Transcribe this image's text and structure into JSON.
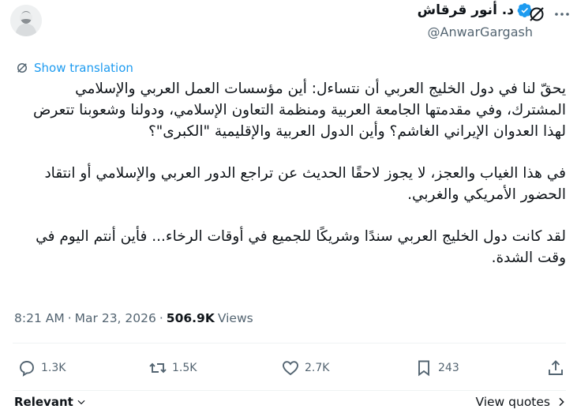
{
  "author": {
    "display_name": "د. أنور قرقاش",
    "handle": "@AnwarGargash"
  },
  "translate_label": "Show translation",
  "tweet": {
    "paragraphs": [
      "يحقّ لنا في دول الخليج العربي أن نتساءل: أين مؤسسات العمل العربي والإسلامي المشترك، وفي مقدمتها الجامعة العربية ومنظمة التعاون الإسلامي، ودولنا وشعوبنا تتعرض لهذا العدوان الإيراني الغاشم؟ وأين الدول العربية والإقليمية \"الكبرى\"؟",
      "في هذا الغياب والعجز، لا يجوز لاحقًا الحديث عن تراجع الدور العربي والإسلامي أو انتقاد الحضور الأمريكي والغربي.",
      "لقد كانت دول الخليج العربي سندًا وشريكًا للجميع في أوقات الرخاء... فأين أنتم اليوم في وقت الشدة."
    ]
  },
  "meta": {
    "time": "8:21 AM",
    "separator": "·",
    "date": "Mar 23, 2026",
    "views_count": "506.9K",
    "views_label": "Views"
  },
  "actions": {
    "replies": "1.3K",
    "reposts": "1.5K",
    "likes": "2.7K",
    "bookmarks": "243"
  },
  "footer": {
    "sort_label": "Relevant",
    "view_quotes": "View quotes"
  },
  "colors": {
    "accent": "#1d9bf0",
    "text": "#0f1419",
    "muted": "#536471"
  }
}
